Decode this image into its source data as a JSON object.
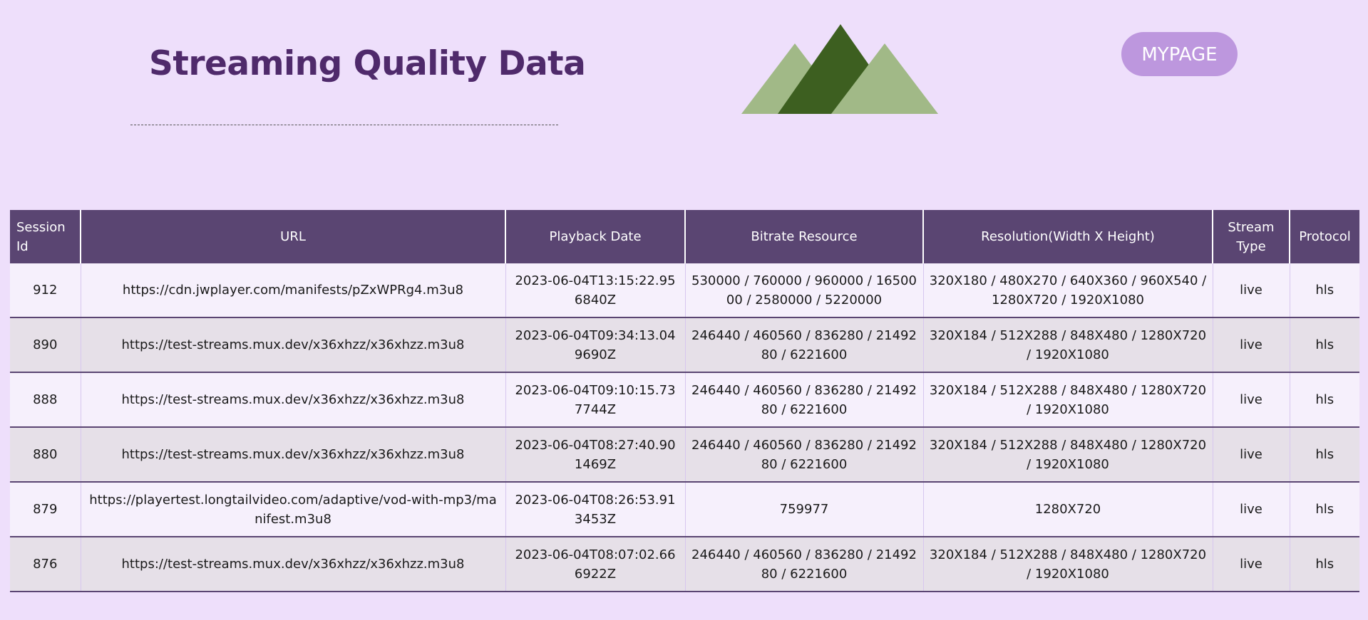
{
  "header": {
    "title": "Streaming Quality Data",
    "mypage_label": "MYPAGE",
    "logo_icon": "mountains-icon"
  },
  "colors": {
    "background": "#eedffb",
    "title": "#4f2a6b",
    "button": "#bd97de",
    "table_header": "#5a4572",
    "row_light": "#f6f0fc",
    "row_dark": "#e6e0e8",
    "mountain_light": "#a1b987",
    "mountain_dark": "#3d5f20"
  },
  "table": {
    "columns": [
      "Session Id",
      "URL",
      "Playback Date",
      "Bitrate Resource",
      "Resolution(Width X Height)",
      "Stream Type",
      "Protocol"
    ],
    "rows": [
      {
        "session_id": "912",
        "url": "https://cdn.jwplayer.com/manifests/pZxWPRg4.m3u8",
        "playback_date": "2023-06-04T13:15:22.956840Z",
        "bitrate": "530000 / 760000 / 960000 / 1650000 / 2580000 / 5220000",
        "resolution": "320X180 / 480X270 / 640X360 / 960X540 / 1280X720 / 1920X1080",
        "stream_type": "live",
        "protocol": "hls"
      },
      {
        "session_id": "890",
        "url": "https://test-streams.mux.dev/x36xhzz/x36xhzz.m3u8",
        "playback_date": "2023-06-04T09:34:13.049690Z",
        "bitrate": "246440 / 460560 / 836280 / 2149280 / 6221600",
        "resolution": "320X184 / 512X288 / 848X480 / 1280X720 / 1920X1080",
        "stream_type": "live",
        "protocol": "hls"
      },
      {
        "session_id": "888",
        "url": "https://test-streams.mux.dev/x36xhzz/x36xhzz.m3u8",
        "playback_date": "2023-06-04T09:10:15.737744Z",
        "bitrate": "246440 / 460560 / 836280 / 2149280 / 6221600",
        "resolution": "320X184 / 512X288 / 848X480 / 1280X720 / 1920X1080",
        "stream_type": "live",
        "protocol": "hls"
      },
      {
        "session_id": "880",
        "url": "https://test-streams.mux.dev/x36xhzz/x36xhzz.m3u8",
        "playback_date": "2023-06-04T08:27:40.901469Z",
        "bitrate": "246440 / 460560 / 836280 / 2149280 / 6221600",
        "resolution": "320X184 / 512X288 / 848X480 / 1280X720 / 1920X1080",
        "stream_type": "live",
        "protocol": "hls"
      },
      {
        "session_id": "879",
        "url": "https://playertest.longtailvideo.com/adaptive/vod-with-mp3/manifest.m3u8",
        "playback_date": "2023-06-04T08:26:53.913453Z",
        "bitrate": "759977",
        "resolution": "1280X720",
        "stream_type": "live",
        "protocol": "hls"
      },
      {
        "session_id": "876",
        "url": "https://test-streams.mux.dev/x36xhzz/x36xhzz.m3u8",
        "playback_date": "2023-06-04T08:07:02.666922Z",
        "bitrate": "246440 / 460560 / 836280 / 2149280 / 6221600",
        "resolution": "320X184 / 512X288 / 848X480 / 1280X720 / 1920X1080",
        "stream_type": "live",
        "protocol": "hls"
      }
    ]
  }
}
